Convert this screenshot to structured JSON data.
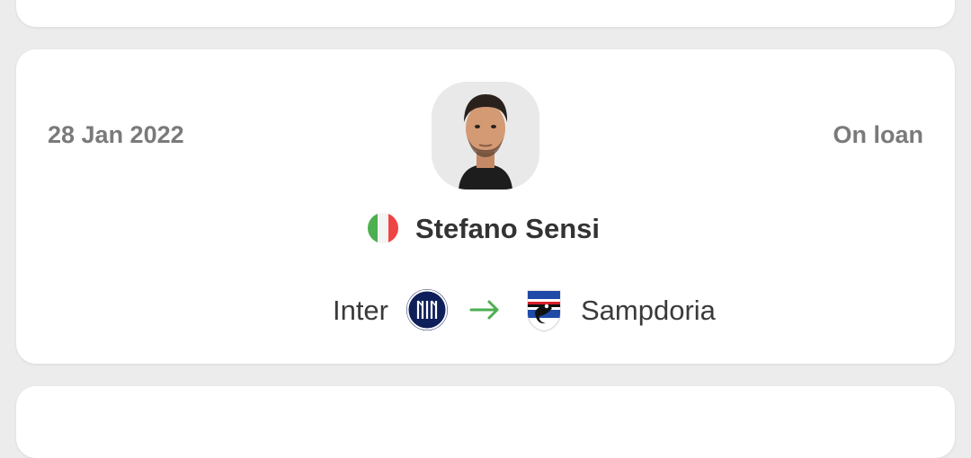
{
  "transfer": {
    "date": "28 Jan 2022",
    "type": "On loan",
    "player": {
      "name": "Stefano Sensi",
      "nationality_flag_colors": [
        "#4caf50",
        "#f4f4f4",
        "#ef4444"
      ]
    },
    "from_club": "Inter",
    "to_club": "Sampdoria",
    "arrow_color": "#4caf50"
  },
  "icons": {
    "from_crest": "inter-crest-icon",
    "to_crest": "sampdoria-crest-icon",
    "arrow": "arrow-right-icon",
    "flag": "italy-flag-icon"
  }
}
